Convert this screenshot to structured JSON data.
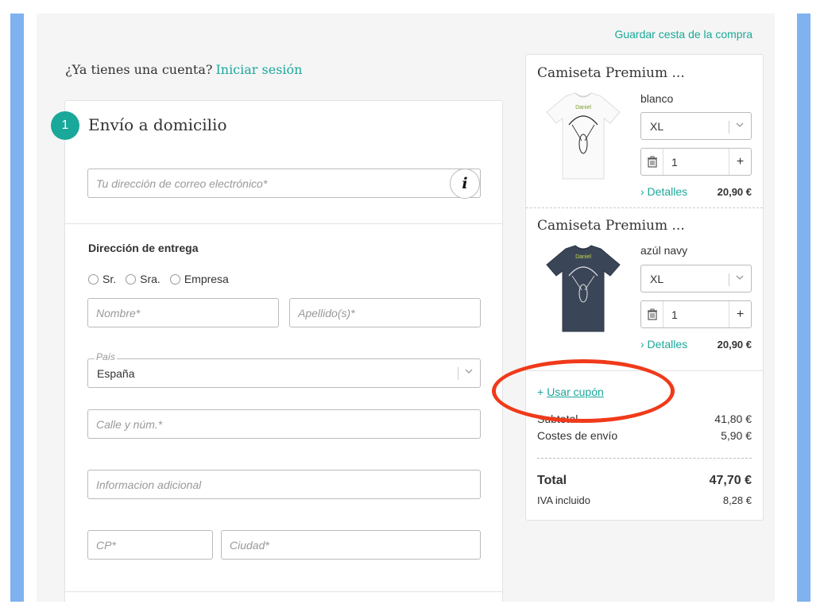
{
  "header": {
    "save_cart": "Guardar cesta de la compra",
    "account_question": "¿Ya tienes una cuenta?",
    "login_link": "Iniciar sesión"
  },
  "checkout": {
    "step_number": "1",
    "step_title": "Envío a domicilio",
    "email_placeholder": "Tu dirección de correo electrónico*",
    "info_icon_label": "i",
    "delivery_label": "Dirección de entrega",
    "salutations": [
      "Sr.",
      "Sra.",
      "Empresa"
    ],
    "first_name_placeholder": "Nombre*",
    "last_name_placeholder": "Apellido(s)*",
    "country_legend": "País",
    "country_value": "España",
    "street_placeholder": "Calle y núm.*",
    "additional_placeholder": "Informacion adicional",
    "zip_placeholder": "CP*",
    "city_placeholder": "Ciudad*"
  },
  "cart": {
    "items": [
      {
        "title": "Camiseta Premium ...",
        "color_name": "blanco",
        "size": "XL",
        "quantity": "1",
        "details": "› Detalles",
        "price": "20,90 €",
        "shirt_color": "#ffffff",
        "print_text": "Daniel"
      },
      {
        "title": "Camiseta Premium ...",
        "color_name": "azúl navy",
        "size": "XL",
        "quantity": "1",
        "details": "› Detalles",
        "price": "20,90 €",
        "shirt_color": "#3a4658",
        "print_text": "Daniel"
      }
    ],
    "coupon_plus": "+",
    "coupon_label": "Usar cupón",
    "subtotal_label": "Subtotal",
    "subtotal_value": "41,80 €",
    "shipping_label": "Costes de envío",
    "shipping_value": "5,90 €",
    "total_label": "Total",
    "total_value": "47,70 €",
    "vat_label": "IVA incluido",
    "vat_value": "8,28 €"
  },
  "colors": {
    "accent": "#1aa89a",
    "highlight_ellipse": "#f03a1a",
    "side_bars": "#7fb2ee"
  }
}
